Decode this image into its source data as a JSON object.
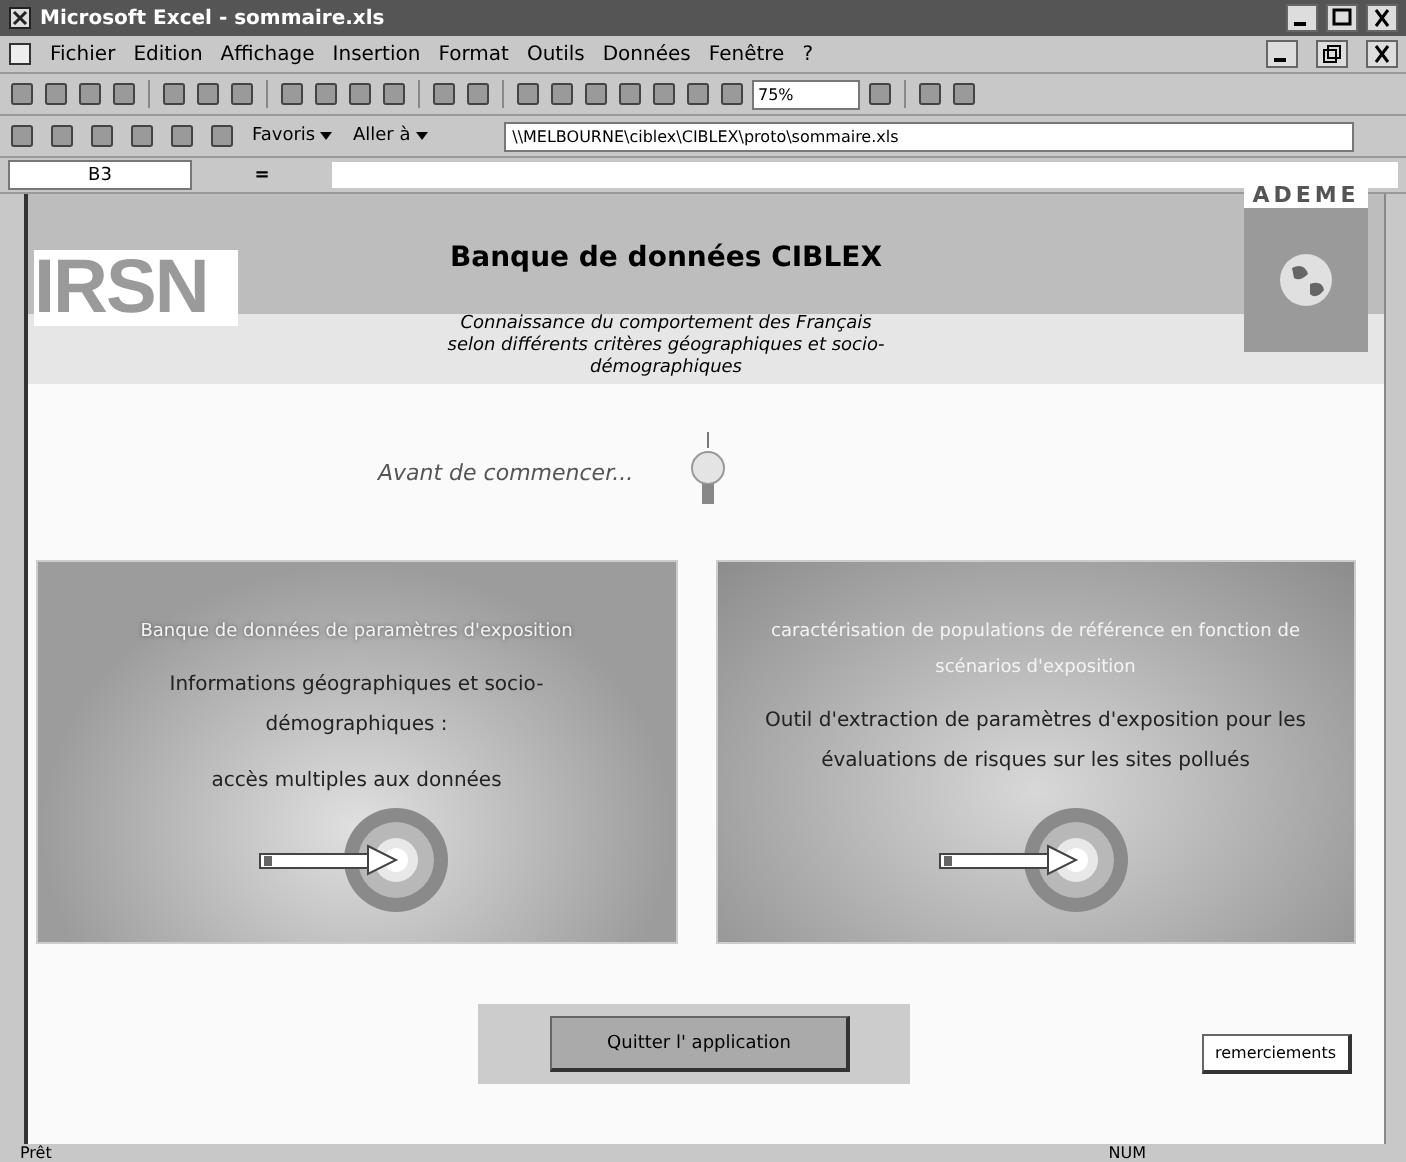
{
  "window": {
    "title": "Microsoft Excel - sommaire.xls"
  },
  "menu": [
    "Fichier",
    "Edition",
    "Affichage",
    "Insertion",
    "Format",
    "Outils",
    "Données",
    "Fenêtre",
    "?"
  ],
  "toolbar": {
    "zoom": "75%"
  },
  "web_toolbar": {
    "favorites": "Favoris",
    "go": "Aller à",
    "address": "\\\\MELBOURNE\\ciblex\\CIBLEX\\proto\\sommaire.xls"
  },
  "formula_bar": {
    "cell": "B3",
    "equals": "="
  },
  "sheet": {
    "logo_left": "IRSN",
    "logo_right": "ADEME",
    "title": "Banque de données CIBLEX",
    "subtitle": "Connaissance du comportement des Français selon différents critères géographiques et socio-démographiques",
    "intro": "Avant de commencer...",
    "panels": [
      {
        "heading": "Banque de données de paramètres d'exposition",
        "lines": [
          "Informations géographiques et socio-démographiques :",
          "accès multiples aux données"
        ]
      },
      {
        "heading": "caractérisation de populations de référence en fonction de scénarios d'exposition",
        "lines": [
          "Outil d'extraction de paramètres d'exposition pour les évaluations de risques sur les sites pollués"
        ]
      }
    ],
    "quit_button": "Quitter l' application",
    "thanks_button": "remerciements"
  },
  "status_bar": {
    "left": "Prêt",
    "right": "NUM"
  }
}
